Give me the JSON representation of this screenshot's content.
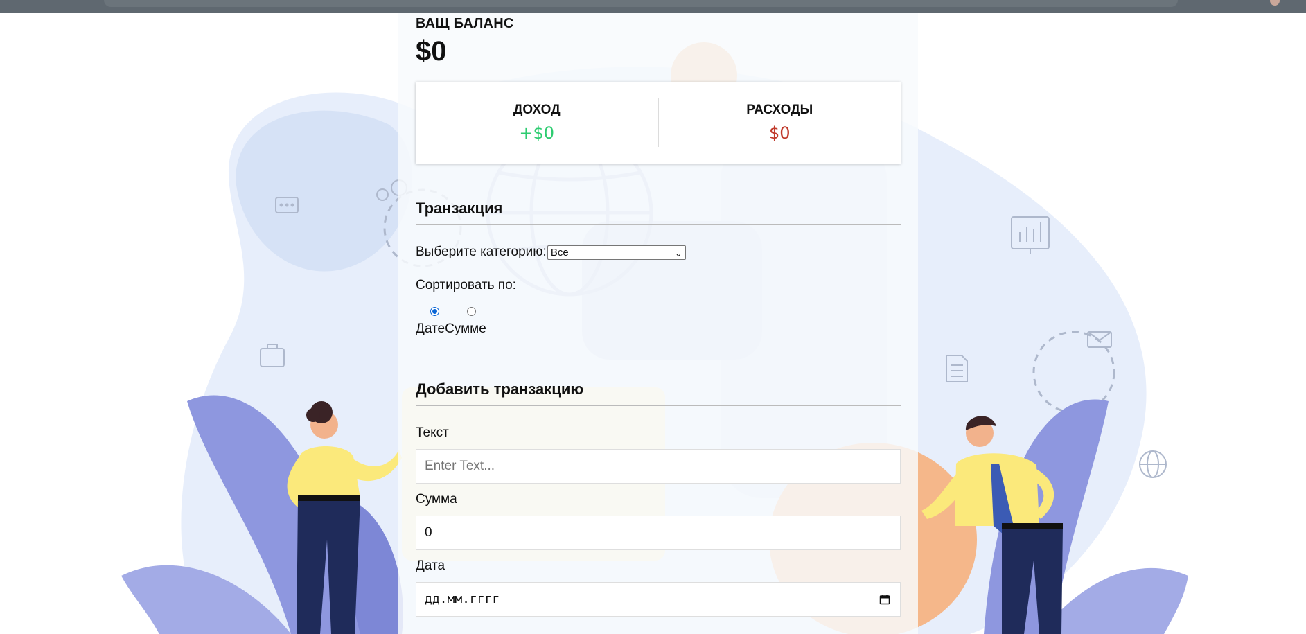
{
  "balance": {
    "title": "ВАЩ БАЛАНС",
    "amount": "$0"
  },
  "summary": {
    "income_label": "ДОХОД",
    "income_value": "+$0",
    "expense_label": "РАСХОДЫ",
    "expense_value": "$0"
  },
  "transactions": {
    "title": "Транзакция",
    "category_label": "Выберите категорию:",
    "category_selected": "Все",
    "sort_label": "Сортировать по:",
    "sort_options": [
      "Дате",
      "Сумме"
    ],
    "sort_selected": "Дате"
  },
  "add_form": {
    "title": "Добавить транзакцию",
    "text_label": "Текст",
    "text_placeholder": "Enter Text...",
    "amount_label": "Сумма",
    "amount_value": "0",
    "date_label": "Дата",
    "date_placeholder": "дд.мм.гггг"
  },
  "colors": {
    "income": "#2ecc71",
    "expense": "#c0392b",
    "radio_accent": "#0b67d6",
    "background_blob": "#e6eefb",
    "leaves": "#8e97df",
    "figure_shirt": "#fbe97b",
    "figure_pants": "#1f2b5a"
  },
  "icons": [
    "chat-icon",
    "gear-icon",
    "briefcase-icon",
    "globe-icon",
    "chart-icon",
    "document-icon",
    "mail-icon",
    "calendar-icon"
  ]
}
